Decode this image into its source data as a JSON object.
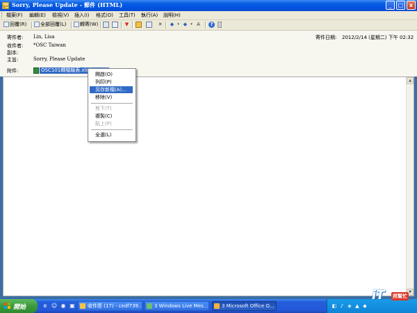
{
  "window": {
    "title": "Sorry, Please Update - 郵件 (HTML)",
    "controls": [
      "_",
      "□",
      "x"
    ]
  },
  "menubar": [
    "檔案(F)",
    "編輯(E)",
    "檢視(V)",
    "插入(I)",
    "格式(O)",
    "工具(T)",
    "執行(A)",
    "說明(H)"
  ],
  "toolbar": {
    "reply": "回覆(R)",
    "reply_all": "全部回覆(L)",
    "forward": "轉寄(W)"
  },
  "header": {
    "from_label": "寄件者:",
    "from_value": "Lin, Lisa",
    "to_label": "收件者:",
    "to_value": "*OSC Taiwan",
    "cc_label": "副本:",
    "cc_value": "",
    "subject_label": "主旨:",
    "subject_value": "Sorry, Please Update",
    "date_label": "寄件日期:",
    "date_value": "2012/2/14 (星期二) 下午 02:32",
    "attach_label": "附件:",
    "attach_value": "OSC101轉檔報表.xls (55 KB)"
  },
  "context_menu": {
    "items": [
      {
        "label": "開啟(O)",
        "state": "normal"
      },
      {
        "label": "列印(P)",
        "state": "normal"
      },
      {
        "label": "另存新檔(A)...",
        "state": "selected"
      },
      {
        "label": "移除(V)",
        "state": "normal"
      },
      {
        "label": "剪下(T)",
        "state": "disabled"
      },
      {
        "label": "複製(C)",
        "state": "normal"
      },
      {
        "label": "貼上(P)",
        "state": "disabled"
      },
      {
        "label": "全選(L)",
        "state": "normal"
      }
    ]
  },
  "taskbar": {
    "start_label": "開始",
    "tasks": [
      {
        "label": "收件匣 (17) - cedf739...",
        "active": false
      },
      {
        "label": "3 Windows Live Mes...",
        "active": false
      },
      {
        "label": "3 Microsoft Office O...",
        "active": true
      }
    ]
  },
  "watermark": {
    "brand": "iT",
    "text": "邦幫忙"
  },
  "colors": {
    "titlebar": "#0a5fe0",
    "selection": "#316ac5",
    "taskbar": "#245edb",
    "start": "#3c9a3c"
  }
}
